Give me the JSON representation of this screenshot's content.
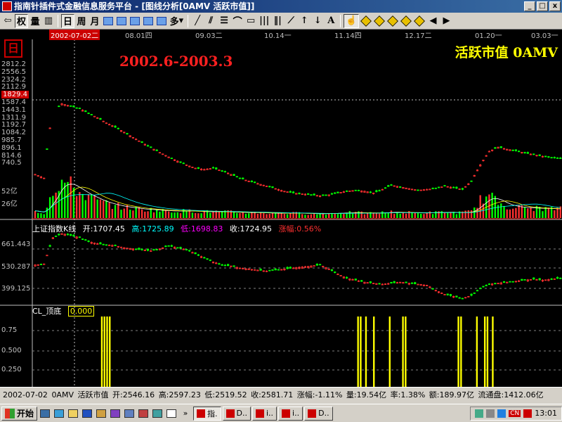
{
  "window": {
    "title": "指南针插件式金融信息服务平台 - [图线分析[0AMV 活跃市值]]",
    "min": "_",
    "max": "□",
    "close": "x"
  },
  "toolbar": {
    "quan": "权",
    "liang": "量",
    "ri": "日",
    "zhou": "周",
    "yue": "月",
    "duo": "多"
  },
  "chart": {
    "period_label": "2002.6-2003.3",
    "stock_title": "活跃市值 0AMV",
    "day_box": "日",
    "dates": [
      {
        "label": "2002-07-02二",
        "first": true
      },
      {
        "label": "08.01四"
      },
      {
        "label": "09.03二"
      },
      {
        "label": "10.14一"
      },
      {
        "label": "11.14四"
      },
      {
        "label": "12.17二"
      },
      {
        "label": "01.20一"
      },
      {
        "label": "03.03一"
      }
    ],
    "price_axis": [
      "2812.2",
      "2556.5",
      "2324.2",
      "2112.9",
      "1829.4",
      "1587.4",
      "1443.1",
      "1311.9",
      "1192.7",
      "1084.2",
      "985.7",
      "896.1",
      "814.6",
      "740.5"
    ],
    "price_axis_highlight": "1829.4",
    "volume_axis": [
      "52亿",
      "26亿"
    ],
    "index_axis": [
      "661.443",
      "530.287",
      "399.125"
    ],
    "cl_axis": [
      "0.75",
      "0.500",
      "0.250"
    ]
  },
  "index_info": {
    "name": "上证指数K线",
    "open": "开:1707.45",
    "high": "高:1725.89",
    "low": "低:1698.83",
    "close": "收:1724.95",
    "change": "涨幅:0.56%"
  },
  "cl_info": {
    "name": "CL_顶底",
    "value": "0.000"
  },
  "status": {
    "date": "2002-07-02",
    "code": "0AMV",
    "name": "活跃市值",
    "open": "开:2546.16",
    "high": "高:2597.23",
    "low": "低:2519.52",
    "close": "收:2581.71",
    "change": "涨幅:-1.11%",
    "volume": "量:19.54亿",
    "rate": "率:1.38%",
    "amount": "额:189.97亿",
    "float": "流通盘:1412.06亿"
  },
  "taskbar": {
    "start": "开始",
    "tasks": [
      {
        "label": "指.",
        "active": true
      },
      {
        "label": "D.."
      },
      {
        "label": "i.."
      },
      {
        "label": "i.."
      },
      {
        "label": "D.."
      }
    ],
    "tray_cn": "CN",
    "clock": "13:01"
  },
  "colors": {
    "up": "#ff3030",
    "down": "#00ff00",
    "accent": "#ffff00",
    "grid": "#c0c0c0"
  },
  "chart_data": [
    {
      "type": "candlestick",
      "title": "活跃市值 0AMV",
      "x_range": [
        "2002-07-02",
        "2003-03-14"
      ],
      "ylim": [
        740.5,
        2812.2
      ],
      "y_scale": "log",
      "close_profile": [
        1110,
        1060,
        2440,
        2680,
        2600,
        2520,
        2380,
        2250,
        2110,
        2000,
        1880,
        1760,
        1650,
        1550,
        1460,
        1380,
        1310,
        1250,
        1200,
        1180,
        1200,
        1160,
        1110,
        1060,
        1020,
        990,
        960,
        930,
        900,
        880,
        870,
        860,
        850,
        860,
        880,
        900,
        910,
        900,
        880,
        920,
        970,
        950,
        930,
        910,
        920,
        930,
        960,
        940,
        920,
        1020,
        1250,
        1480,
        1560,
        1520,
        1490,
        1450,
        1420,
        1390,
        1370,
        1350
      ]
    },
    {
      "type": "bar",
      "title": "volume",
      "ylim": [
        0,
        65
      ],
      "ylabel": "亿",
      "values_profile": [
        12,
        8,
        48,
        60,
        54,
        42,
        36,
        28,
        24,
        20,
        18,
        16,
        14,
        14,
        12,
        12,
        11,
        12,
        11,
        10,
        11,
        10,
        10,
        9,
        9,
        9,
        8,
        8,
        8,
        8,
        8,
        7,
        7,
        8,
        8,
        9,
        9,
        8,
        8,
        9,
        10,
        9,
        9,
        8,
        9,
        9,
        10,
        9,
        9,
        11,
        30,
        36,
        26,
        20,
        18,
        17,
        16,
        16,
        15,
        15
      ]
    },
    {
      "type": "candlestick",
      "title": "上证指数K线",
      "ylim": [
        360,
        700
      ],
      "close_profile": [
        545,
        550,
        680,
        700,
        690,
        680,
        660,
        650,
        645,
        640,
        630,
        625,
        620,
        615,
        625,
        640,
        630,
        620,
        600,
        580,
        560,
        545,
        540,
        530,
        525,
        520,
        515,
        520,
        525,
        530,
        535,
        540,
        545,
        525,
        500,
        480,
        470,
        460,
        455,
        450,
        455,
        460,
        455,
        450,
        445,
        420,
        400,
        390,
        380,
        395,
        430,
        450,
        455,
        460,
        465,
        470,
        475,
        470,
        475,
        480
      ]
    },
    {
      "type": "bar",
      "title": "CL_顶底",
      "ylim": [
        0,
        1
      ],
      "signal_positions": [
        0.13,
        0.135,
        0.14,
        0.145,
        0.615,
        0.62,
        0.63,
        0.645,
        0.675,
        0.7,
        0.705,
        0.805,
        0.81,
        0.84,
        0.855,
        0.86,
        0.87
      ]
    }
  ]
}
